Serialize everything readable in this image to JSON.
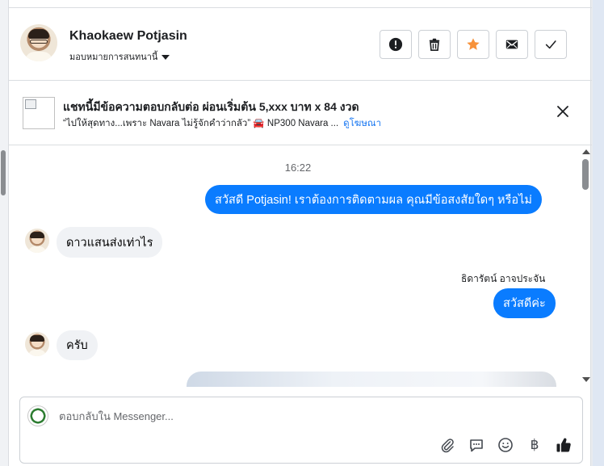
{
  "header": {
    "contact_name": "Khaokaew Potjasin",
    "assign_label": "มอบหมายการสนทนานี้",
    "actions": [
      {
        "name": "report-button",
        "icon": "alert-circle-icon"
      },
      {
        "name": "delete-button",
        "icon": "trash-icon"
      },
      {
        "name": "star-button",
        "icon": "star-icon"
      },
      {
        "name": "mark-unread-button",
        "icon": "envelope-icon"
      },
      {
        "name": "mark-done-button",
        "icon": "checkmark-icon"
      }
    ]
  },
  "ad": {
    "title": "แชทนี้มีข้อความตอบกลับต่อ ผ่อนเริ่มต้น 5,xxx บาท x 84 งวด",
    "subtitle": "“ไปให้สุดทาง...เพราะ Navara ไม่รู้จักคำว่ากลัว” 🚘 NP300 Navara ...",
    "link_label": "ดูโฆษณา",
    "close_icon": "close-icon"
  },
  "thread": {
    "timestamp": "16:22",
    "messages": [
      {
        "direction": "out",
        "text": "สวัสดี Potjasin! เราต้องการติดตามผล คุณมีข้อสงสัยใดๆ หรือไม่"
      },
      {
        "direction": "in",
        "text": "ดาวแสนส่งเท่าไร"
      },
      {
        "direction": "out",
        "sender": "ธิดารัตน์ อาจประจัน",
        "text": "สวัสดีค่ะ"
      },
      {
        "direction": "in",
        "text": "ครับ"
      }
    ]
  },
  "composer": {
    "placeholder": "ตอบกลับใน Messenger...",
    "icons": [
      "paperclip-icon",
      "saved-replies-icon",
      "emoji-icon",
      "baht-icon",
      "thumbs-up-icon"
    ],
    "baht_symbol": "฿"
  },
  "colors": {
    "accent": "#0a7cff",
    "star": "#f7923a",
    "link": "#1877f2"
  }
}
